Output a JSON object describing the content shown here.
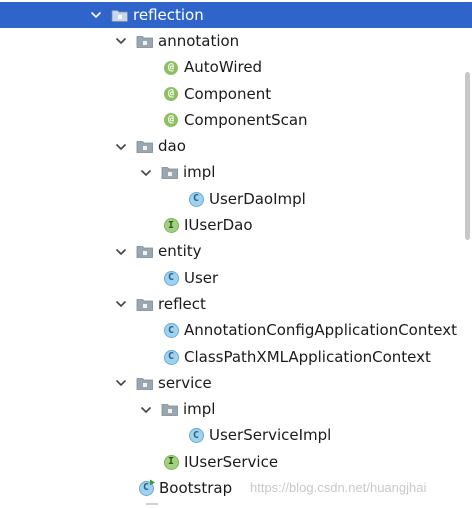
{
  "tree": [
    {
      "label": "reflection",
      "type": "package",
      "depth": 0,
      "expanded": true,
      "selected": true
    },
    {
      "label": "annotation",
      "type": "package",
      "depth": 1,
      "expanded": true
    },
    {
      "label": "AutoWired",
      "type": "annotation",
      "depth": 2
    },
    {
      "label": "Component",
      "type": "annotation",
      "depth": 2
    },
    {
      "label": "ComponentScan",
      "type": "annotation",
      "depth": 2
    },
    {
      "label": "dao",
      "type": "package",
      "depth": 1,
      "expanded": true
    },
    {
      "label": "impl",
      "type": "package",
      "depth": 2,
      "expanded": true
    },
    {
      "label": "UserDaoImpl",
      "type": "class",
      "depth": 3
    },
    {
      "label": "IUserDao",
      "type": "interface",
      "depth": 2
    },
    {
      "label": "entity",
      "type": "package",
      "depth": 1,
      "expanded": true
    },
    {
      "label": "User",
      "type": "class",
      "depth": 2
    },
    {
      "label": "reflect",
      "type": "package",
      "depth": 1,
      "expanded": true
    },
    {
      "label": "AnnotationConfigApplicationContext",
      "type": "class",
      "depth": 2
    },
    {
      "label": "ClassPathXMLApplicationContext",
      "type": "class",
      "depth": 2
    },
    {
      "label": "service",
      "type": "package",
      "depth": 1,
      "expanded": true
    },
    {
      "label": "impl",
      "type": "package",
      "depth": 2,
      "expanded": true
    },
    {
      "label": "UserServiceImpl",
      "type": "class",
      "depth": 3
    },
    {
      "label": "IUserService",
      "type": "interface",
      "depth": 2
    },
    {
      "label": "Bootstrap",
      "type": "runnable-class",
      "depth": 1
    }
  ],
  "icons": {
    "annotation": "@",
    "class": "C",
    "interface": "I"
  },
  "colors": {
    "selection": "#2f65ca",
    "annotation_icon": "#8fbf63",
    "class_icon": "#9fd2f0",
    "interface_icon": "#a2cf80",
    "folder_icon": "#9aa7b0"
  },
  "watermark": "https://blog.csdn.net/huangjhai"
}
